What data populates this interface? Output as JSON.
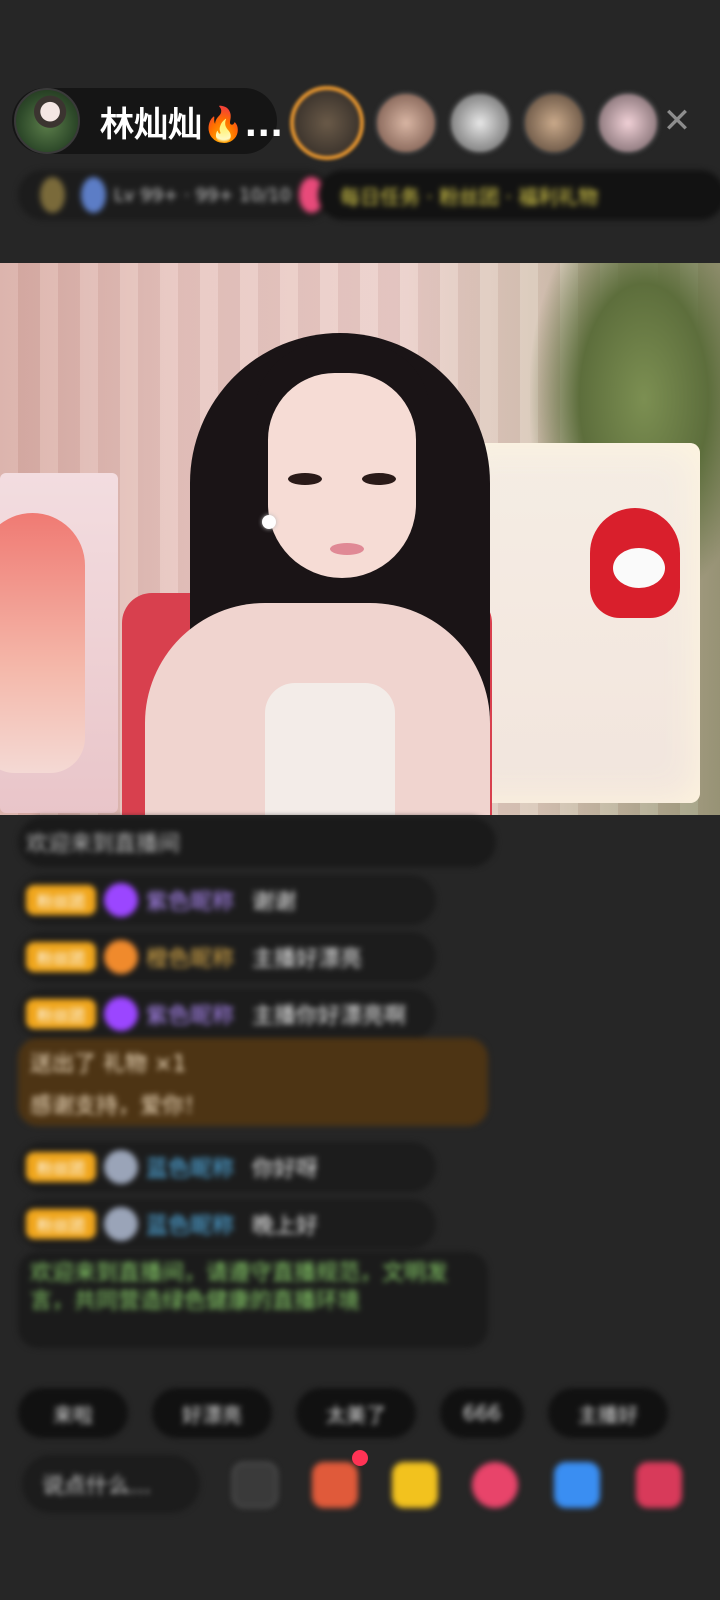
{
  "header": {
    "host_name": "林灿灿🔥...",
    "close_icon": "close-icon",
    "info_strip": {
      "rank_text": "Lv 99+ · 99+ 10/10",
      "task_text": "每日任务 · 粉丝团 · 福利礼物"
    }
  },
  "chat": {
    "intro": "欢迎来到直播间",
    "messages": [
      {
        "badge": "粉丝团",
        "user": "紫色昵称",
        "text": "谢谢"
      },
      {
        "badge": "粉丝团",
        "user": "橙色昵称",
        "text": "主播好漂亮"
      },
      {
        "badge": "粉丝团",
        "user": "紫色昵称",
        "text": "主播你好漂亮啊"
      },
      {
        "badge": "粉丝团",
        "user": "蓝色昵称",
        "text": "你好呀"
      },
      {
        "badge": "粉丝团",
        "user": "蓝色昵称",
        "text": "晚上好"
      }
    ],
    "gift": {
      "line1": "送出了 礼物 ×1",
      "line2": "感谢支持，爱你！"
    },
    "system": "欢迎来到直播间，请遵守直播规范，文明发言，共同营造绿色健康的直播环境"
  },
  "quick_replies": [
    "来啦",
    "好漂亮",
    "太美了",
    "666",
    "主播好"
  ],
  "bottom": {
    "input_placeholder": "说点什么..."
  },
  "colors": {
    "background": "#262626",
    "badge": "#f0a61c",
    "gift_bg": "#4d3414",
    "system_text": "#8bd36b"
  }
}
